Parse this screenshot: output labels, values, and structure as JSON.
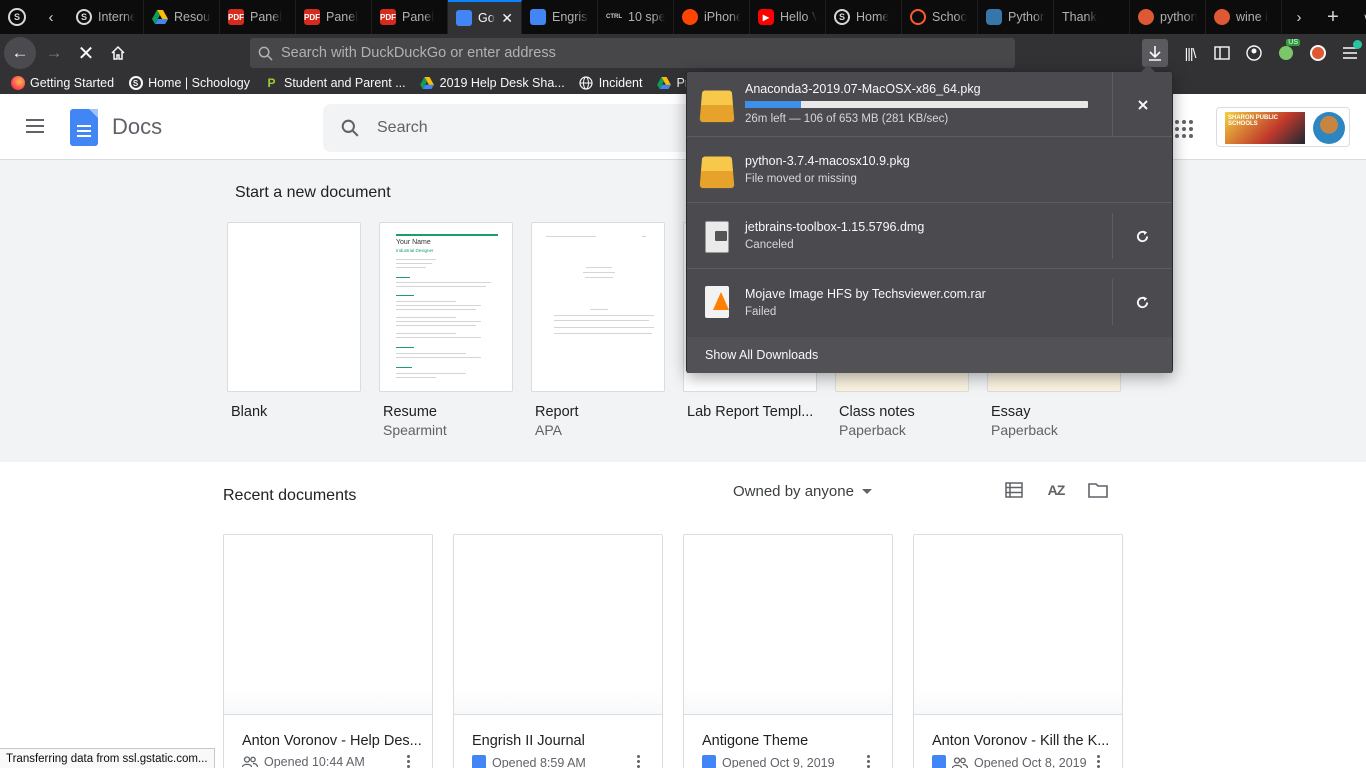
{
  "tabs": [
    {
      "title": "Internet",
      "favicon": "schoology-icon"
    },
    {
      "title": "Resources",
      "favicon": "drive-icon"
    },
    {
      "title": "Panel",
      "favicon": "pdf-icon"
    },
    {
      "title": "Panel",
      "favicon": "pdf-icon"
    },
    {
      "title": "Panel",
      "favicon": "pdf-icon"
    },
    {
      "title": "Go",
      "favicon": "docs-icon",
      "active": true
    },
    {
      "title": "Engrish",
      "favicon": "docs-icon"
    },
    {
      "title": "10 spe",
      "favicon": "ctrl-icon"
    },
    {
      "title": "iPhone",
      "favicon": "reddit-icon"
    },
    {
      "title": "Hello V",
      "favicon": "youtube-icon"
    },
    {
      "title": "Home",
      "favicon": "schoology-icon"
    },
    {
      "title": "Schoo",
      "favicon": "arc-icon"
    },
    {
      "title": "Python",
      "favicon": "python-icon"
    },
    {
      "title": "Thank",
      "favicon": "none"
    },
    {
      "title": "python",
      "favicon": "duckduckgo-icon"
    },
    {
      "title": "wine i",
      "favicon": "duckduckgo-icon"
    }
  ],
  "urlbar": {
    "placeholder": "Search with DuckDuckGo or enter address"
  },
  "bookmarks": [
    {
      "label": "Getting Started",
      "icon": "firefox-icon"
    },
    {
      "label": "Home | Schoology",
      "icon": "schoology-icon"
    },
    {
      "label": "Student and Parent ...",
      "icon": "pearson-icon"
    },
    {
      "label": "2019 Help Desk Sha...",
      "icon": "drive-icon"
    },
    {
      "label": "Incident",
      "icon": "globe-icon"
    },
    {
      "label": "Programs",
      "icon": "drive-icon"
    }
  ],
  "docs": {
    "app_name": "Docs",
    "search_placeholder": "Search",
    "school_logo_text": "SHARON PUBLIC SCHOOLS"
  },
  "templates": {
    "heading": "Start a new document",
    "items": [
      {
        "name": "Blank",
        "sub": ""
      },
      {
        "name": "Resume",
        "sub": "Spearmint",
        "preview_title": "Your Name",
        "preview_subtitle": "Industrial Designer"
      },
      {
        "name": "Report",
        "sub": "APA"
      },
      {
        "name": "Lab Report Templ...",
        "sub": ""
      },
      {
        "name": "Class notes",
        "sub": "Paperback"
      },
      {
        "name": "Essay",
        "sub": "Paperback"
      }
    ]
  },
  "recent": {
    "heading": "Recent documents",
    "owner_filter": "Owned by anyone",
    "docs": [
      {
        "name": "Anton Voronov - Help Des...",
        "opened": "Opened 10:44 AM",
        "shared": true
      },
      {
        "name": "Engrish II Journal",
        "opened": "Opened 8:59 AM",
        "shared": false
      },
      {
        "name": "Antigone Theme",
        "opened": "Opened Oct 9, 2019",
        "shared": false
      },
      {
        "name": "Anton Voronov - Kill the K...",
        "opened": "Opened Oct 8, 2019",
        "shared": true
      }
    ]
  },
  "downloads": {
    "items": [
      {
        "name": "Anaconda3-2019.07-MacOSX-x86_64.pkg",
        "status": "26m left — 106 of 653 MB (281 KB/sec)",
        "progress": 0.162,
        "action": "cancel-icon",
        "icon": "package-icon"
      },
      {
        "name": "python-3.7.4-macosx10.9.pkg",
        "status": "File moved or missing",
        "action": "none",
        "icon": "package-icon"
      },
      {
        "name": "jetbrains-toolbox-1.15.5796.dmg",
        "status": "Canceled",
        "action": "retry-icon",
        "icon": "disk-image-icon"
      },
      {
        "name": "Mojave Image HFS by Techsviewer.com.rar",
        "status": "Failed",
        "action": "retry-icon",
        "icon": "vlc-archive-icon"
      }
    ],
    "footer": "Show All Downloads"
  },
  "statusbar": {
    "text": "Transferring data from ssl.gstatic.com..."
  }
}
